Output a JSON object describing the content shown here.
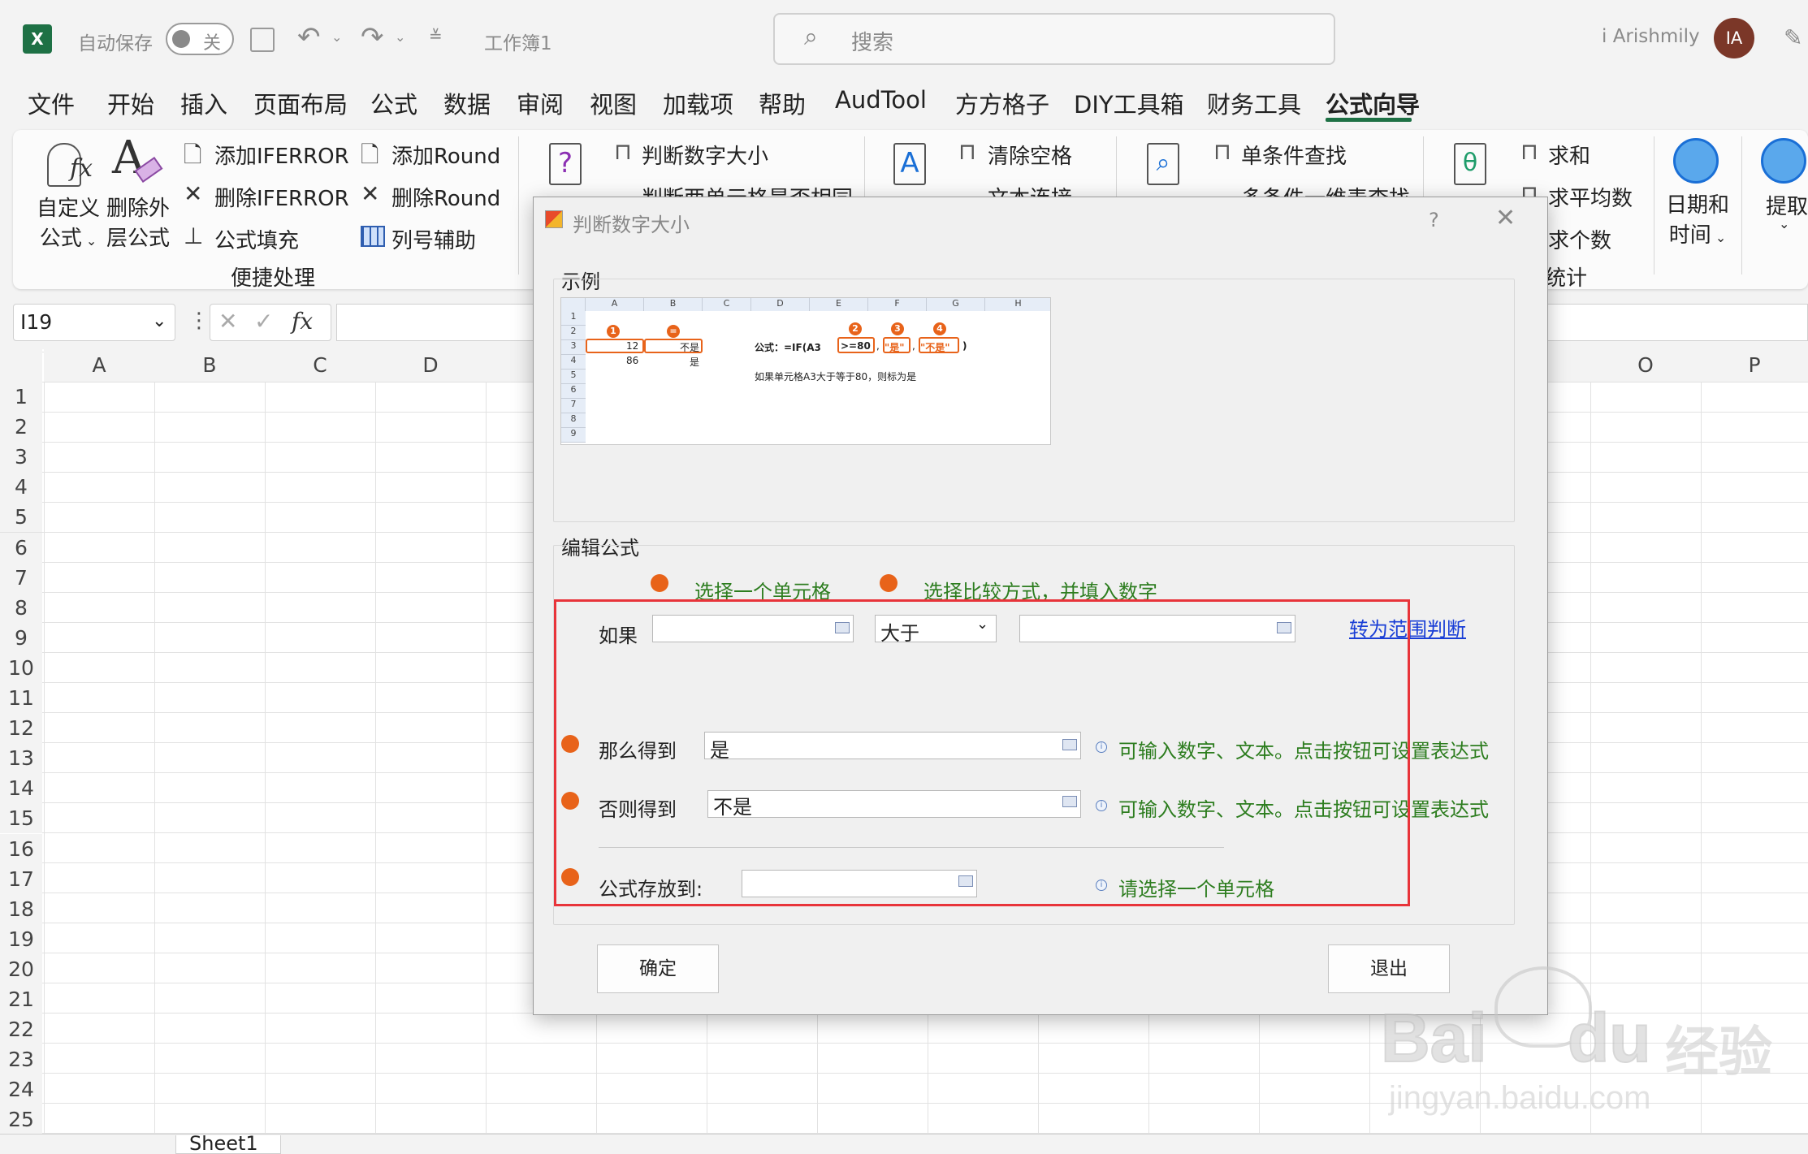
{
  "titlebar": {
    "autosave_label": "自动保存",
    "autosave_state": "关",
    "workbook_name": "工作簿1",
    "search_placeholder": "搜索",
    "user_name": "i Arishmily",
    "user_initials": "IA"
  },
  "menu_tabs": [
    "文件",
    "开始",
    "插入",
    "页面布局",
    "公式",
    "数据",
    "审阅",
    "视图",
    "加载项",
    "帮助",
    "AudTool",
    "方方格子",
    "DIY工具箱",
    "财务工具",
    "公式向导"
  ],
  "active_tab": "公式向导",
  "ribbon": {
    "custom_formula": [
      "自定义",
      "公式"
    ],
    "remove_outer": [
      "删除外",
      "层公式"
    ],
    "add_iferror": "添加IFERROR",
    "remove_iferror": "删除IFERROR",
    "formula_fill": "公式填充",
    "add_round": "添加Round",
    "remove_round": "删除Round",
    "column_helper": "列号辅助",
    "group_quick": "便捷处理",
    "judge_number": "判断数字大小",
    "judge_cells": "判断两单元格是否相同",
    "clear_spaces": "清除空格",
    "text_concat": "文本连接",
    "single_lookup": "单条件查找",
    "multi_lookup": "多条件一维表查找",
    "sum": "求和",
    "average": "求平均数",
    "count": "求个数",
    "group_stats": "统计",
    "datetime": [
      "日期和",
      "时间"
    ],
    "extract": "提取"
  },
  "formula_bar": {
    "name_box": "I19",
    "fx": "fx"
  },
  "grid": {
    "columns": [
      "A",
      "B",
      "C",
      "D",
      "O",
      "P"
    ],
    "rows": [
      "1",
      "2",
      "3",
      "4",
      "5",
      "6",
      "7",
      "8",
      "9",
      "10",
      "11",
      "12",
      "13",
      "14",
      "15",
      "16",
      "17",
      "18",
      "19",
      "20",
      "21",
      "22",
      "23",
      "24",
      "25"
    ],
    "sheet_tab": "Sheet1"
  },
  "dialog": {
    "title": "判断数字大小",
    "help": "?",
    "section_example": "示例",
    "example": {
      "cols": [
        "A",
        "B",
        "C",
        "D",
        "E",
        "F",
        "G",
        "H"
      ],
      "rows": [
        "1",
        "2",
        "3",
        "4",
        "5",
        "6",
        "7",
        "8",
        "9"
      ],
      "a3": "12",
      "b3": "不是",
      "a4": "86",
      "b4": "是",
      "formula_label": "公式：=IF(A3",
      "cond": ">=80",
      "yes": "\"是\"",
      "no": "\"不是\"",
      "close_paren": ")",
      "explain": "如果单元格A3大于等于80，则标为是",
      "badges": [
        "1",
        "2",
        "3",
        "4"
      ]
    },
    "section_edit": "编辑公式",
    "hint1": "选择一个单元格",
    "hint2": "选择比较方式，并填入数字",
    "if_label": "如果",
    "compare_value": "大于",
    "range_link": "转为范围判断",
    "then_label": "那么得到",
    "then_value": "是",
    "then_hint": "可输入数字、文本。点击按钮可设置表达式",
    "else_label": "否则得到",
    "else_value": "不是",
    "else_hint": "可输入数字、文本。点击按钮可设置表达式",
    "store_label": "公式存放到:",
    "store_hint": "请选择一个单元格",
    "ok": "确定",
    "exit": "退出"
  },
  "watermark": {
    "brand": "Bai",
    "brand2": "du",
    "cn": "经验",
    "url": "jingyan.baidu.com"
  },
  "colors": {
    "excel_green": "#1e7145",
    "accent_orange": "#e8631a",
    "frame_red": "#e8343a",
    "hint_green": "#2d7d1f",
    "link_blue": "#1a3fd6"
  }
}
